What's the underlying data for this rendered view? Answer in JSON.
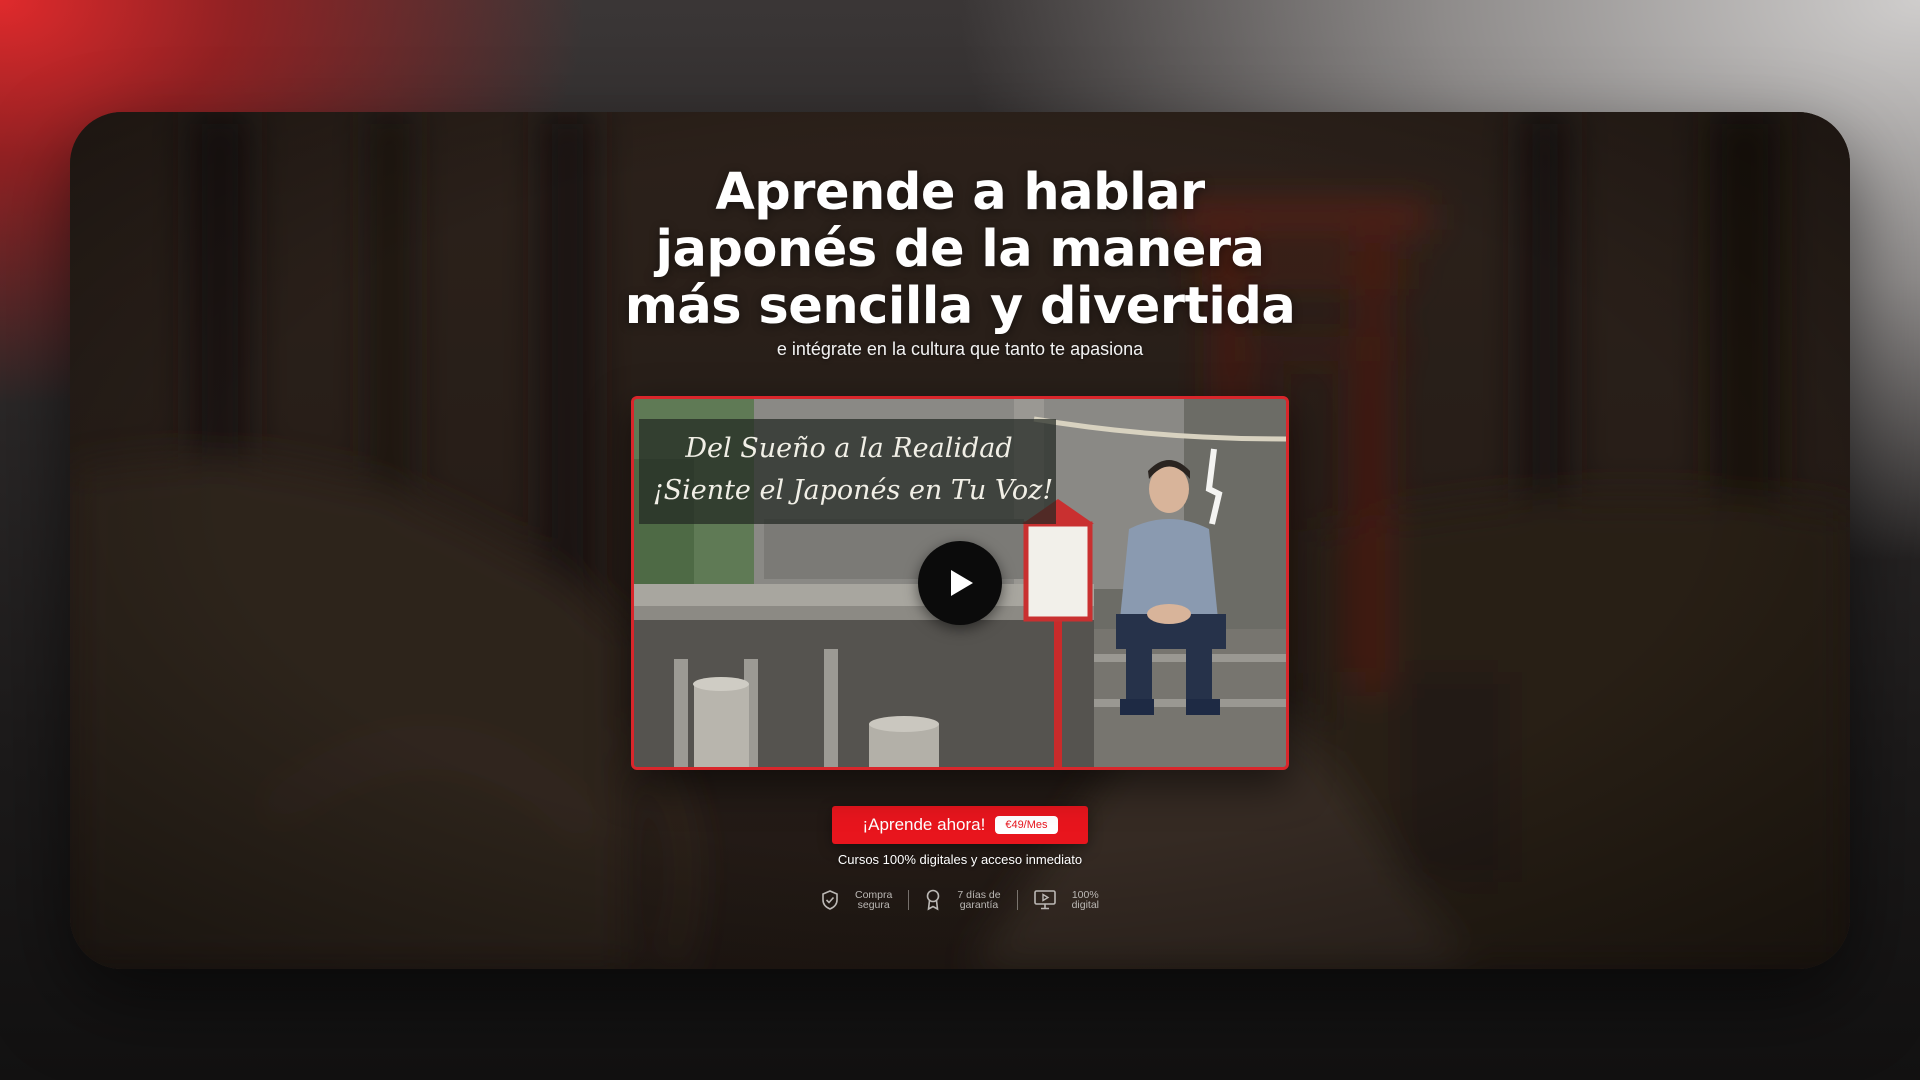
{
  "hero": {
    "headline": [
      "Aprende a hablar",
      "japonés de la manera",
      "más sencilla y divertida"
    ],
    "subheadline": "e intégrate en la cultura que tanto te apasiona"
  },
  "video": {
    "overlay_line_1": "Del Sueño a la Realidad",
    "overlay_line_2": "¡Siente el Japonés en Tu Voz!",
    "play_icon": "play-icon"
  },
  "cta": {
    "label": "¡Aprende ahora!",
    "price": "€49/Mes",
    "note": "Cursos 100% digitales y acceso inmediato"
  },
  "badges": [
    {
      "icon": "shield-check-icon",
      "line1": "Compra",
      "line2": "segura"
    },
    {
      "icon": "award-ribbon-icon",
      "line1": "7 días de",
      "line2": "garantía"
    },
    {
      "icon": "monitor-play-icon",
      "line1": "100%",
      "line2": "digital"
    }
  ],
  "colors": {
    "accent": "#e8151d",
    "video_border": "#d9262b",
    "background_red": "#e02a2c",
    "card_dark": "#2e251f"
  }
}
